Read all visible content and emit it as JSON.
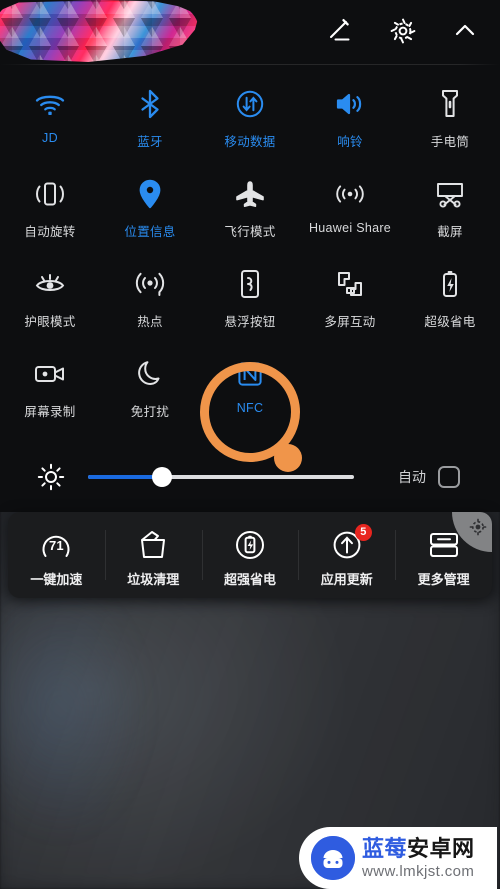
{
  "statusbar": {
    "redaction_name": "mosaic-redaction-stroke",
    "icons": [
      {
        "name": "edit-icon",
        "label": "编辑"
      },
      {
        "name": "settings-gear-icon",
        "label": "设置"
      },
      {
        "name": "collapse-chevron-up-icon",
        "label": "收起"
      }
    ]
  },
  "colors": {
    "accent_on": "#2a8cf0",
    "accent_off": "#e2e3e5",
    "slider_fill": "#1a6ae0",
    "annotation": "#f0954a",
    "badge": "#e8251f",
    "panel_bg": "#1b1c1e",
    "shade_bg": "#0d0e10"
  },
  "tiles": [
    [
      {
        "label": "JD",
        "icon": "wifi-icon",
        "state": "on"
      },
      {
        "label": "蓝牙",
        "icon": "bluetooth-icon",
        "state": "on"
      },
      {
        "label": "移动数据",
        "icon": "mobile-data-icon",
        "state": "on"
      },
      {
        "label": "响铃",
        "icon": "ringer-volume-icon",
        "state": "on"
      },
      {
        "label": "手电筒",
        "icon": "flashlight-icon",
        "state": "off"
      }
    ],
    [
      {
        "label": "自动旋转",
        "icon": "auto-rotate-icon",
        "state": "off"
      },
      {
        "label": "位置信息",
        "icon": "location-pin-icon",
        "state": "on"
      },
      {
        "label": "飞行模式",
        "icon": "airplane-icon",
        "state": "off"
      },
      {
        "label": "Huawei Share",
        "icon": "huawei-share-icon",
        "state": "off"
      },
      {
        "label": "截屏",
        "icon": "screenshot-icon",
        "state": "off"
      }
    ],
    [
      {
        "label": "护眼模式",
        "icon": "eye-comfort-icon",
        "state": "off"
      },
      {
        "label": "热点",
        "icon": "hotspot-icon",
        "state": "off"
      },
      {
        "label": "悬浮按钮",
        "icon": "floating-button-icon",
        "state": "off"
      },
      {
        "label": "多屏互动",
        "icon": "multi-screen-icon",
        "state": "off"
      },
      {
        "label": "超级省电",
        "icon": "ultra-power-saving-icon",
        "state": "off"
      }
    ],
    [
      {
        "label": "屏幕录制",
        "icon": "screen-record-icon",
        "state": "off"
      },
      {
        "label": "免打扰",
        "icon": "do-not-disturb-moon-icon",
        "state": "off"
      },
      {
        "label": "NFC",
        "icon": "nfc-icon",
        "state": "on"
      },
      {
        "label": "",
        "icon": "",
        "state": "empty"
      },
      {
        "label": "",
        "icon": "",
        "state": "empty"
      }
    ]
  ],
  "brightness": {
    "icon": "brightness-sun-icon",
    "value_percent": 28,
    "auto_label": "自动",
    "auto_checked": false
  },
  "manager": {
    "gear_icon": "manager-settings-gear-icon",
    "items": [
      {
        "label": "一键加速",
        "icon": "speed-gauge-icon",
        "value": "71",
        "badge": ""
      },
      {
        "label": "垃圾清理",
        "icon": "trash-clean-icon",
        "value": "",
        "badge": ""
      },
      {
        "label": "超强省电",
        "icon": "power-saving-battery-icon",
        "value": "",
        "badge": ""
      },
      {
        "label": "应用更新",
        "icon": "app-update-icon",
        "value": "",
        "badge": "5"
      },
      {
        "label": "更多管理",
        "icon": "more-manage-icon",
        "value": "",
        "badge": ""
      }
    ]
  },
  "annotation": {
    "name": "highlight-circle-nfc",
    "target": "NFC"
  },
  "watermark": {
    "brand_blue": "蓝莓",
    "brand_black": "安卓网",
    "url": "www.lmkjst.com"
  }
}
